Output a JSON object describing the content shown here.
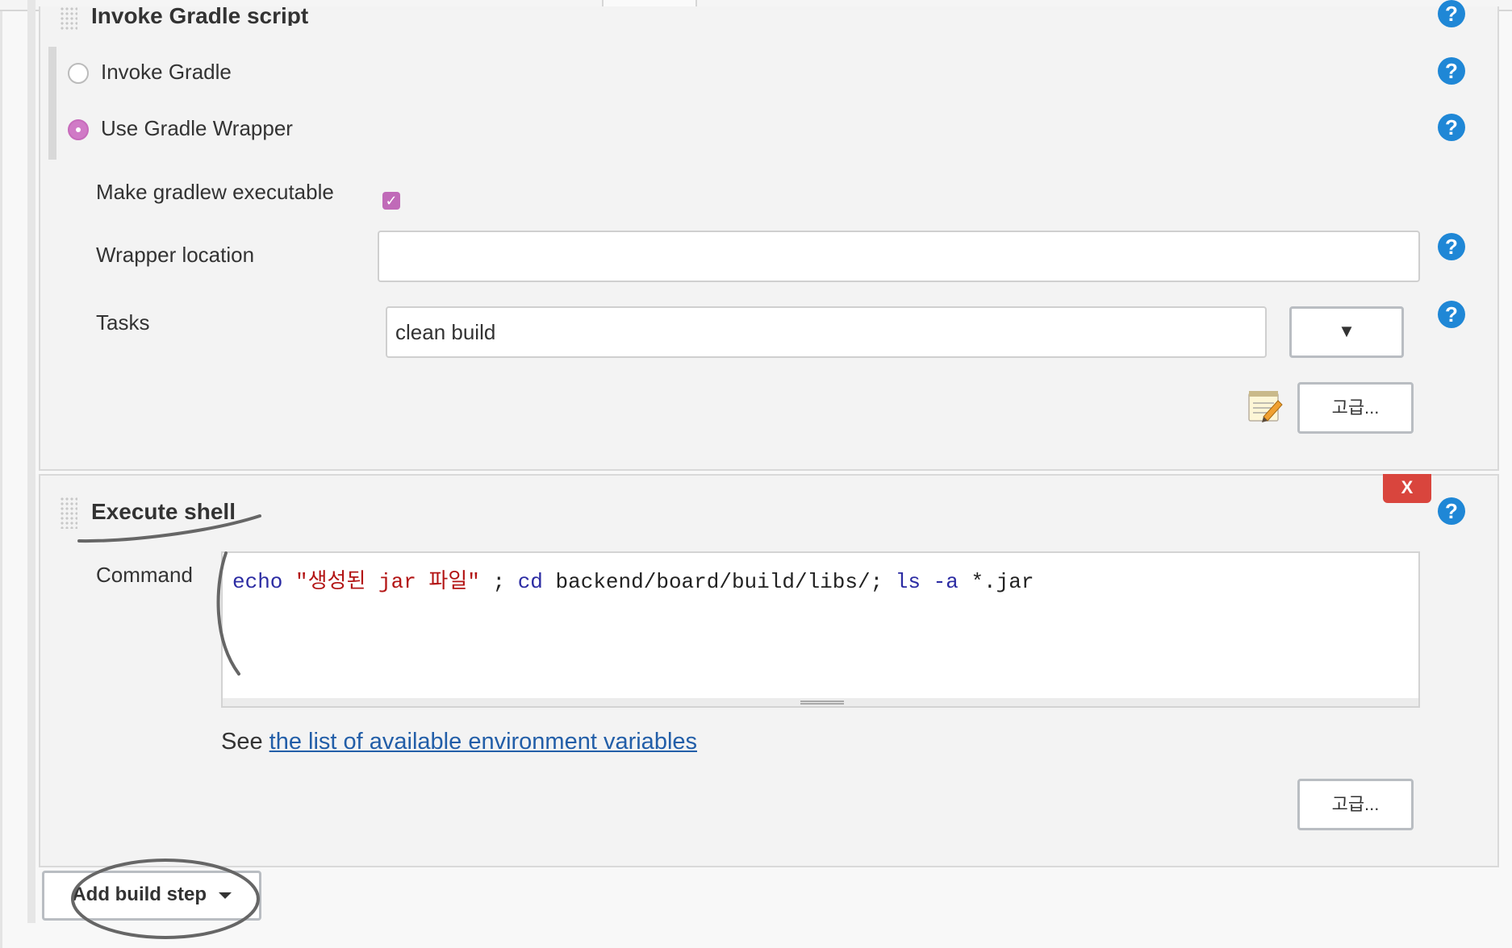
{
  "gradle_step": {
    "title": "Invoke Gradle script",
    "radio_invoke_gradle": "Invoke Gradle",
    "radio_use_wrapper": "Use Gradle Wrapper",
    "make_executable_label": "Make gradlew executable",
    "make_executable_checked": true,
    "wrapper_location_label": "Wrapper location",
    "wrapper_location_value": "",
    "tasks_label": "Tasks",
    "tasks_value": "clean build",
    "tasks_expand_symbol": "▼",
    "advanced_label": "고급..."
  },
  "shell_step": {
    "title": "Execute shell",
    "delete_label": "X",
    "command_label": "Command",
    "command_tokens": {
      "echo": "echo",
      "string": "\"생성된 jar 파일\"",
      "semi": " ;",
      "cd": "cd",
      "path": "backend/board/build/libs/;",
      "ls": "ls",
      "flag": "-a",
      "glob": "*.jar"
    },
    "see_prefix": "See",
    "env_link": "the list of available environment variables",
    "advanced_label": "고급..."
  },
  "add_build_step_label": "Add build step",
  "help_symbol": "?",
  "icons": {
    "help": "help-icon",
    "grip": "drag-handle-icon",
    "notepad": "notepad-pencil-icon",
    "dropdown": "caret-down-icon"
  },
  "colors": {
    "help_blue": "#1f87d6",
    "radio_selected": "#d07ac6",
    "delete_red": "#d9453d",
    "link_blue": "#225ea8",
    "keyword_blue": "#2c2ca3",
    "string_red": "#b31515"
  }
}
